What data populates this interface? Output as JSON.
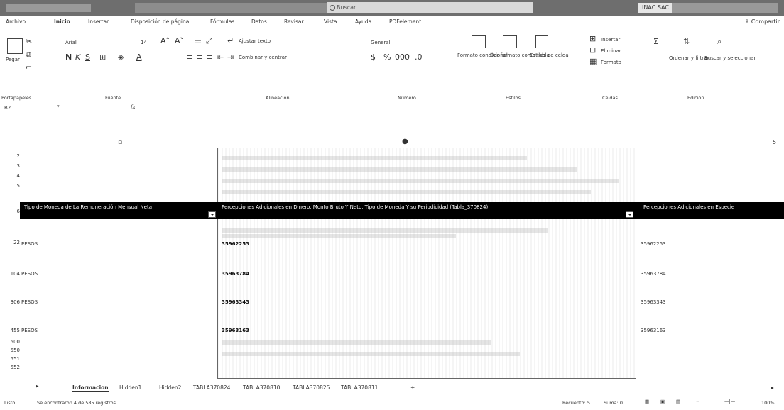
{
  "title_bar": {
    "document_title": "",
    "search_placeholder": "Buscar",
    "user_badge": "INAC SAC"
  },
  "menu": {
    "items": [
      "Archivo",
      "Inicio",
      "Insertar",
      "Disposición de página",
      "Fórmulas",
      "Datos",
      "Revisar",
      "Vista",
      "Ayuda",
      "PDFelement"
    ],
    "active": "Inicio",
    "share_label": "Compartir"
  },
  "ribbon": {
    "paste_label": "Pegar",
    "font_name": "Arial",
    "font_size": "14",
    "wrap_text": "Ajustar texto",
    "merge_center": "Combinar y centrar",
    "number_format": "General",
    "conditional_format": "Formato condicional",
    "format_as_table": "Dar formato como tabla",
    "cell_styles": "Estilos de celda",
    "insert": "Insertar",
    "delete": "Eliminar",
    "format": "Formato",
    "sort_filter": "Ordenar y filtrar",
    "find_select": "Buscar y seleccionar",
    "groups": {
      "clipboard": "Portapapeles",
      "font": "Fuente",
      "alignment": "Alineación",
      "number": "Número",
      "styles": "Estilos",
      "cells": "Celdas",
      "editing": "Edición"
    }
  },
  "formula_bar": {
    "name_box": "B2",
    "fx": "fx",
    "content": ""
  },
  "sheet": {
    "column_headers": [
      "Tipo de Moneda de La Remuneración Mensual Neta",
      "Percepciones Adicionales en Dinero, Monto Bruto Y Neto, Tipo de Moneda Y su Periodicidad (Tabla_370824)",
      "Percepciones Adicionales en Especie"
    ],
    "row_numbers": [
      "2",
      "3",
      "4",
      "5",
      "6",
      "22",
      "104",
      "306",
      "455",
      "500",
      "550",
      "551",
      "552"
    ],
    "rows": [
      {
        "col1": "PESOS",
        "col2": "35962253",
        "col3": "35962253"
      },
      {
        "col1": "PESOS",
        "col2": "35963784",
        "col3": "35963784"
      },
      {
        "col1": "PESOS",
        "col2": "35963343",
        "col3": "35963343"
      },
      {
        "col1": "PESOS",
        "col2": "35963163",
        "col3": "35963163"
      }
    ]
  },
  "tabs": {
    "items": [
      "Informacion",
      "Hidden1",
      "Hidden2",
      "TABLA370824",
      "TABLA370810",
      "TABLA370825",
      "TABLA370811"
    ],
    "active": "Informacion",
    "more": "..."
  },
  "status_bar": {
    "mode": "Listo",
    "records": "Se encontraron 4 de 585 registros",
    "count": "Recuento: 5",
    "sum": "Suma: 0",
    "zoom": "100%"
  }
}
